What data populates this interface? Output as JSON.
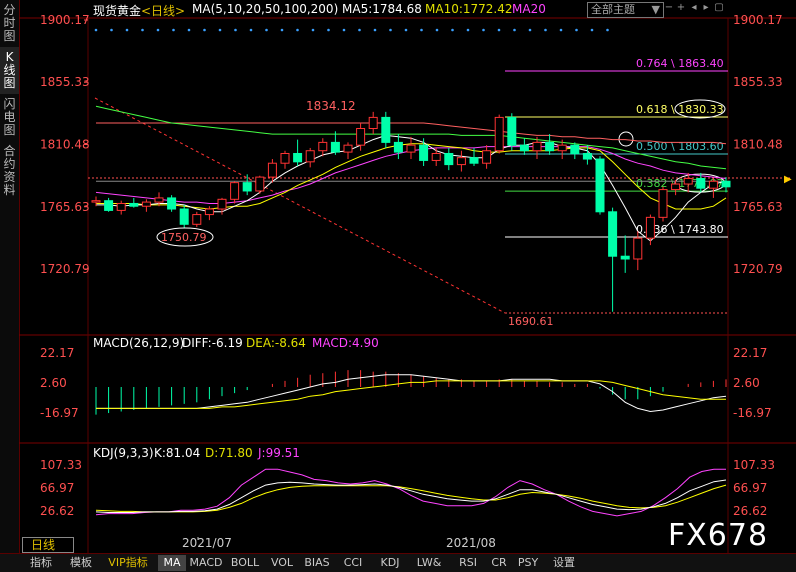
{
  "left_tabs": [
    {
      "label": "分时图",
      "active": false
    },
    {
      "label": "K线图",
      "active": true
    },
    {
      "label": "闪电图",
      "active": false
    },
    {
      "label": "合约资料",
      "active": false
    }
  ],
  "header": {
    "symbol": "现货黄金",
    "period": "<日线>",
    "ma_label": "MA(5,10,20,50,100,200)",
    "ma5": "MA5:1784.68",
    "ma10": "MA10:1772.42",
    "ma20": "MA20",
    "theme_select": "全部主题",
    "theme_arrow": "▼"
  },
  "price_axis": {
    "labels": [
      "1900.17",
      "1855.33",
      "1810.48",
      "1765.63",
      "1720.79"
    ],
    "values": [
      1900.17,
      1855.33,
      1810.48,
      1765.63,
      1720.79
    ]
  },
  "fib_levels": [
    {
      "ratio": 0.764,
      "label": "0.764 \\ 1863.40",
      "color": "#ff44ff"
    },
    {
      "ratio": 0.618,
      "label": "0.618 \\ 1830.33",
      "color": "#ffff66"
    },
    {
      "ratio": 0.5,
      "label": "0.500 \\ 1803.60",
      "color": "#44c8c8"
    },
    {
      "ratio": 0.382,
      "label": "0.382 \\ 1776.87",
      "color": "#44dd44"
    },
    {
      "ratio": 0.236,
      "label": "0.236 \\ 1743.80",
      "color": "#ffffff"
    }
  ],
  "annotations": {
    "high": "1834.12",
    "low1": "1750.79",
    "low2": "1690.61"
  },
  "macd": {
    "title": "MACD(26,12,9)",
    "diff": "DIFF:-6.19",
    "dea": "DEA:-8.64",
    "macd": "MACD:4.90",
    "axis": [
      "22.17",
      "2.60",
      "-16.97"
    ]
  },
  "kdj": {
    "title": "KDJ(9,3,3)",
    "k": "K:81.04",
    "d": "D:71.80",
    "j": "J:99.51",
    "axis": [
      "107.33",
      "66.97",
      "26.62"
    ]
  },
  "dates": [
    "2021/07",
    "2021/08"
  ],
  "period_select": "日线",
  "bottom_tabs": [
    "指标",
    "模板",
    "VIP指标",
    "MA",
    "MACD",
    "BOLL",
    "VOL",
    "BIAS",
    "CCI",
    "KDJ",
    "LW&",
    "RSI",
    "CR",
    "PSY",
    "设置"
  ],
  "watermark": "FX678",
  "colors": {
    "up": "#ff3333",
    "down": "#00ffaa",
    "ma5": "#ffffff",
    "ma10": "#ffff00",
    "ma20": "#ff44ff",
    "ma50": "#44ff44",
    "ma100": "#ff6060",
    "ma200": "#888888"
  },
  "chart_data": {
    "type": "candlestick",
    "candles": [
      [
        1769,
        1773,
        1766,
        1770
      ],
      [
        1770,
        1772,
        1762,
        1763
      ],
      [
        1763,
        1770,
        1760,
        1768
      ],
      [
        1768,
        1772,
        1765,
        1766
      ],
      [
        1766,
        1771,
        1762,
        1769
      ],
      [
        1769,
        1776,
        1766,
        1772
      ],
      [
        1772,
        1774,
        1762,
        1764
      ],
      [
        1764,
        1767,
        1750,
        1753
      ],
      [
        1753,
        1762,
        1751,
        1760
      ],
      [
        1760,
        1766,
        1756,
        1764
      ],
      [
        1764,
        1772,
        1760,
        1771
      ],
      [
        1771,
        1784,
        1768,
        1783
      ],
      [
        1783,
        1789,
        1774,
        1777
      ],
      [
        1777,
        1788,
        1775,
        1787
      ],
      [
        1787,
        1800,
        1783,
        1797
      ],
      [
        1797,
        1806,
        1793,
        1804
      ],
      [
        1804,
        1814,
        1795,
        1798
      ],
      [
        1798,
        1808,
        1794,
        1806
      ],
      [
        1806,
        1815,
        1802,
        1812
      ],
      [
        1812,
        1820,
        1803,
        1805
      ],
      [
        1805,
        1812,
        1800,
        1810
      ],
      [
        1810,
        1826,
        1806,
        1822
      ],
      [
        1822,
        1834,
        1818,
        1830
      ],
      [
        1830,
        1834,
        1808,
        1812
      ],
      [
        1812,
        1818,
        1800,
        1805
      ],
      [
        1805,
        1816,
        1800,
        1810
      ],
      [
        1810,
        1815,
        1795,
        1799
      ],
      [
        1799,
        1808,
        1795,
        1804
      ],
      [
        1804,
        1808,
        1792,
        1796
      ],
      [
        1796,
        1806,
        1791,
        1801
      ],
      [
        1801,
        1808,
        1795,
        1797
      ],
      [
        1797,
        1810,
        1793,
        1806
      ],
      [
        1806,
        1832,
        1804,
        1830
      ],
      [
        1830,
        1833,
        1806,
        1810
      ],
      [
        1810,
        1815,
        1803,
        1806
      ],
      [
        1806,
        1816,
        1800,
        1812
      ],
      [
        1812,
        1818,
        1803,
        1806
      ],
      [
        1806,
        1814,
        1800,
        1810
      ],
      [
        1810,
        1812,
        1800,
        1804
      ],
      [
        1804,
        1810,
        1796,
        1800
      ],
      [
        1800,
        1802,
        1760,
        1762
      ],
      [
        1762,
        1765,
        1690,
        1730
      ],
      [
        1730,
        1745,
        1718,
        1728
      ],
      [
        1728,
        1748,
        1720,
        1743
      ],
      [
        1743,
        1760,
        1738,
        1758
      ],
      [
        1758,
        1780,
        1755,
        1778
      ],
      [
        1778,
        1785,
        1774,
        1782
      ],
      [
        1782,
        1790,
        1776,
        1786
      ],
      [
        1786,
        1790,
        1776,
        1779
      ],
      [
        1779,
        1786,
        1772,
        1784
      ],
      [
        1784,
        1787,
        1776,
        1780
      ]
    ],
    "ma5": [
      1767,
      1767,
      1766,
      1767,
      1767,
      1768,
      1768,
      1767,
      1764,
      1762,
      1762,
      1766,
      1770,
      1776,
      1784,
      1790,
      1795,
      1799,
      1803,
      1805,
      1806,
      1810,
      1814,
      1817,
      1816,
      1815,
      1812,
      1806,
      1803,
      1802,
      1801,
      1801,
      1807,
      1810,
      1810,
      1812,
      1812,
      1809,
      1808,
      1806,
      1796,
      1781,
      1765,
      1748,
      1741,
      1749,
      1758,
      1769,
      1776,
      1782,
      1784
    ],
    "ma10": [
      1768,
      1768,
      1768,
      1768,
      1767,
      1767,
      1767,
      1766,
      1765,
      1764,
      1765,
      1766,
      1766,
      1768,
      1772,
      1776,
      1781,
      1785,
      1789,
      1794,
      1798,
      1802,
      1805,
      1808,
      1810,
      1811,
      1811,
      1810,
      1809,
      1808,
      1806,
      1805,
      1805,
      1806,
      1806,
      1806,
      1806,
      1807,
      1808,
      1808,
      1806,
      1798,
      1789,
      1780,
      1772,
      1768,
      1764,
      1764,
      1764,
      1766,
      1772
    ],
    "ma20": [
      1776,
      1775,
      1774,
      1773,
      1772,
      1771,
      1770,
      1769,
      1769,
      1768,
      1768,
      1769,
      1770,
      1772,
      1774,
      1777,
      1779,
      1782,
      1786,
      1790,
      1793,
      1796,
      1799,
      1802,
      1804,
      1806,
      1807,
      1808,
      1808,
      1808,
      1808,
      1809,
      1809,
      1809,
      1809,
      1809,
      1809,
      1809,
      1809,
      1809,
      1807,
      1804,
      1800,
      1797,
      1795,
      1792,
      1790,
      1789,
      1788,
      1787,
      1786
    ],
    "ma50": [
      1838,
      1836,
      1834,
      1832,
      1830,
      1828,
      1826,
      1825,
      1824,
      1823,
      1822,
      1821,
      1820,
      1819,
      1818,
      1818,
      1818,
      1818,
      1818,
      1818,
      1818,
      1818,
      1818,
      1818,
      1818,
      1818,
      1818,
      1818,
      1818,
      1817,
      1817,
      1817,
      1817,
      1816,
      1815,
      1814,
      1813,
      1812,
      1811,
      1810,
      1809,
      1808,
      1806,
      1804,
      1802,
      1800,
      1798,
      1797,
      1795,
      1794,
      1793
    ],
    "ma100": [
      1826,
      1826,
      1826,
      1826,
      1826,
      1826,
      1826,
      1826,
      1826,
      1826,
      1826,
      1826,
      1826,
      1826,
      1826,
      1826,
      1826,
      1826,
      1826,
      1826,
      1826,
      1826,
      1826,
      1826,
      1826,
      1826,
      1826,
      1825,
      1824,
      1823,
      1822,
      1821,
      1820,
      1819,
      1818,
      1817,
      1817,
      1816,
      1816,
      1815,
      1815,
      1814,
      1814,
      1813,
      1813,
      1812,
      1812,
      1812,
      1812,
      1812,
      1811
    ],
    "ma200": [
      1784,
      1784,
      1784,
      1784,
      1784,
      1784,
      1784,
      1784,
      1784,
      1784,
      1784,
      1784,
      1784,
      1784,
      1784,
      1784,
      1784,
      1784,
      1784,
      1784,
      1784,
      1784,
      1784,
      1784,
      1784,
      1784,
      1784,
      1784,
      1784,
      1784,
      1784,
      1784,
      1784,
      1784,
      1784,
      1784,
      1784,
      1784,
      1784,
      1784,
      1784,
      1784,
      1784,
      1784,
      1784,
      1784,
      1784,
      1784,
      1784,
      1784,
      1784
    ],
    "macd_hist": [
      -18,
      -17,
      -16,
      -15,
      -14,
      -13,
      -12,
      -11,
      -10,
      -8,
      -6,
      -4,
      -2,
      0,
      2,
      4,
      6,
      8,
      9,
      10,
      11,
      11,
      10,
      10,
      9,
      8,
      7,
      6,
      5,
      5,
      4,
      4,
      5,
      5,
      4,
      4,
      3,
      3,
      2,
      2,
      -1,
      -5,
      -8,
      -8,
      -6,
      -3,
      0,
      2,
      3,
      4,
      5
    ],
    "macd_diff": [
      -14,
      -14,
      -14,
      -14,
      -14,
      -14,
      -14,
      -14,
      -14,
      -13,
      -12,
      -11,
      -10,
      -8,
      -6,
      -4,
      -2,
      0,
      2,
      3,
      5,
      6,
      7,
      8,
      8,
      8,
      7,
      6,
      5,
      4,
      4,
      4,
      4,
      5,
      5,
      5,
      5,
      4,
      4,
      4,
      2,
      -3,
      -10,
      -14,
      -16,
      -15,
      -13,
      -11,
      -9,
      -7,
      -6
    ],
    "macd_dea": [
      -14,
      -14,
      -14,
      -14,
      -14,
      -14,
      -14,
      -14,
      -14,
      -14,
      -13,
      -13,
      -12,
      -11,
      -10,
      -9,
      -8,
      -6,
      -5,
      -3,
      -2,
      -1,
      0,
      1,
      2,
      3,
      3,
      4,
      4,
      4,
      4,
      4,
      4,
      4,
      4,
      4,
      4,
      4,
      4,
      4,
      4,
      3,
      1,
      -1,
      -3,
      -5,
      -6,
      -7,
      -8,
      -8,
      -8
    ],
    "kdj_k": [
      25,
      24,
      24,
      24,
      25,
      25,
      25,
      26,
      26,
      27,
      30,
      38,
      50,
      62,
      72,
      76,
      77,
      76,
      74,
      73,
      72,
      72,
      73,
      74,
      72,
      68,
      62,
      56,
      52,
      48,
      46,
      44,
      44,
      48,
      56,
      64,
      64,
      60,
      56,
      50,
      44,
      38,
      34,
      30,
      29,
      30,
      34,
      40,
      50,
      62,
      70,
      78,
      81
    ],
    "kdj_d": [
      28,
      27,
      26,
      26,
      25,
      25,
      25,
      25,
      25,
      26,
      28,
      33,
      40,
      50,
      58,
      64,
      68,
      70,
      71,
      71,
      71,
      71,
      71,
      71,
      71,
      69,
      66,
      62,
      58,
      54,
      51,
      48,
      46,
      46,
      50,
      56,
      59,
      58,
      56,
      53,
      49,
      44,
      40,
      36,
      33,
      32,
      33,
      36,
      42,
      50,
      58,
      66,
      72
    ],
    "kdj_j": [
      20,
      22,
      22,
      22,
      24,
      25,
      25,
      28,
      28,
      30,
      35,
      50,
      72,
      86,
      100,
      100,
      95,
      90,
      82,
      80,
      76,
      74,
      76,
      80,
      74,
      66,
      54,
      44,
      40,
      36,
      36,
      36,
      40,
      52,
      68,
      80,
      74,
      64,
      56,
      44,
      34,
      26,
      22,
      18,
      22,
      26,
      36,
      50,
      66,
      86,
      96,
      100,
      100
    ]
  }
}
